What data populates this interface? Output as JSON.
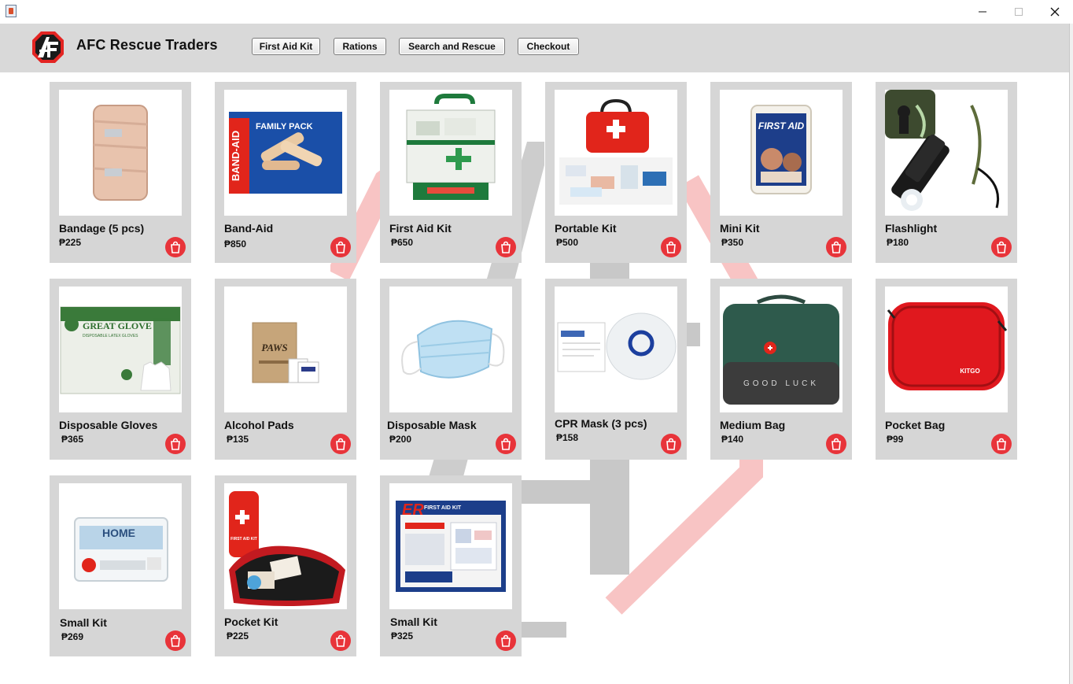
{
  "window": {
    "app_icon": "java-cup-icon"
  },
  "header": {
    "brand": "AFC Rescue Traders",
    "logo_letters": "AF",
    "nav": [
      "First Aid Kit",
      "Rations",
      "Search and Rescue",
      "Checkout"
    ]
  },
  "colors": {
    "header_bg": "#d9d9d9",
    "card_bg": "#d6d6d6",
    "cart_button": "#e8343a",
    "watermark_red": "#f7b8b8",
    "watermark_gray": "#c8c8c8"
  },
  "products": [
    {
      "name": "Bandage (5 pcs)",
      "price": "₱225",
      "image": "elastic-bandage"
    },
    {
      "name": "Band-Aid",
      "price": "₱850",
      "image": "band-aid-family-pack",
      "image_text": [
        "BAND-AID",
        "FAMILY PACK"
      ]
    },
    {
      "name": "First Aid Kit",
      "price": "₱650",
      "image": "first-aid-storage-box"
    },
    {
      "name": "Portable Kit",
      "price": "₱500",
      "image": "red-portable-kit-bag"
    },
    {
      "name": "Mini Kit",
      "price": "₱350",
      "image": "mini-first-aid-kit",
      "image_text": [
        "FIRST AID"
      ]
    },
    {
      "name": "Flashlight",
      "price": "₱180",
      "image": "tactical-flashlight"
    },
    {
      "name": "Disposable Gloves",
      "price": "₱365",
      "image": "glove-box",
      "image_text": [
        "GREAT GLOVE",
        "DISPOSABLE LATEX GLOVES"
      ]
    },
    {
      "name": "Alcohol Pads",
      "price": "₱135",
      "image": "alcohol-pads-box",
      "image_text": [
        "PAWS"
      ]
    },
    {
      "name": "Disposable Mask",
      "price": "₱200",
      "image": "surgical-mask"
    },
    {
      "name": "CPR Mask (3 pcs)",
      "price": "₱158",
      "image": "cpr-face-shield"
    },
    {
      "name": "Medium Bag",
      "price": "₱140",
      "image": "green-medical-bag",
      "image_text": [
        "GOOD LUCK"
      ]
    },
    {
      "name": "Pocket Bag",
      "price": "₱99",
      "image": "red-pocket-case",
      "image_text": [
        "KITGO"
      ]
    },
    {
      "name": "Small Kit",
      "price": "₱269",
      "image": "home-first-aid-kit",
      "image_text": [
        "HOME"
      ]
    },
    {
      "name": "Pocket Kit",
      "price": "₱225",
      "image": "pocket-first-aid-kit",
      "image_text": [
        "FIRST AID KIT"
      ]
    },
    {
      "name": "Small Kit",
      "price": "₱325",
      "image": "er-first-aid-kit",
      "image_text": [
        "ER",
        "FIRST AID KIT"
      ]
    }
  ]
}
